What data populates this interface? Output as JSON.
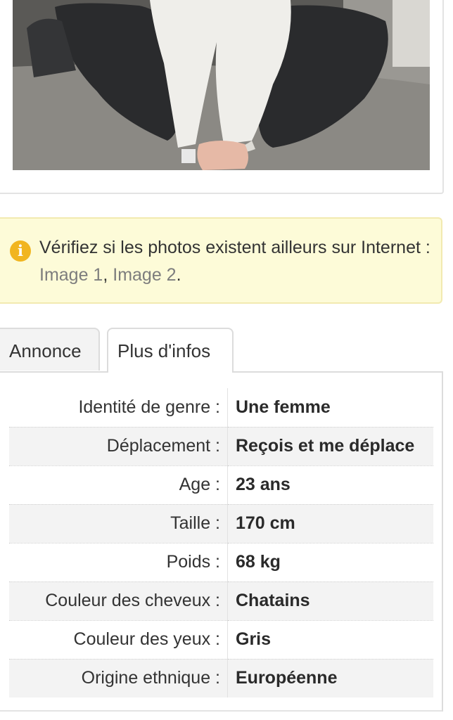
{
  "photo": {
    "description_icon": "photo-image"
  },
  "notice": {
    "icon": "info-icon",
    "text_before": "Vérifiez si les photos existent ailleurs sur Internet : ",
    "link1": "Image 1",
    "separator": ", ",
    "link2": "Image 2",
    "text_after": ".",
    "icon_color": "#f1b520",
    "background_color": "#fdfbd8"
  },
  "tabs": [
    {
      "label": "Annonce",
      "active": false
    },
    {
      "label": "Plus d'infos",
      "active": true
    }
  ],
  "details": [
    {
      "label": "Identité de genre :",
      "value": "Une femme"
    },
    {
      "label": "Déplacement :",
      "value": "Reçois et me déplace"
    },
    {
      "label": "Age :",
      "value": "23 ans"
    },
    {
      "label": "Taille :",
      "value": "170 cm"
    },
    {
      "label": "Poids :",
      "value": "68 kg"
    },
    {
      "label": "Couleur des cheveux :",
      "value": "Chatains"
    },
    {
      "label": "Couleur des yeux :",
      "value": "Gris"
    },
    {
      "label": "Origine ethnique :",
      "value": "Européenne"
    }
  ]
}
